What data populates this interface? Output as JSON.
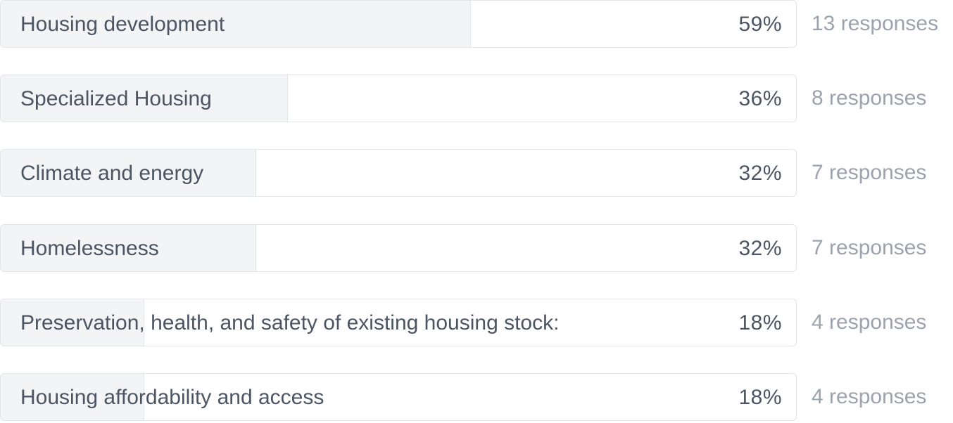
{
  "chart_data": {
    "type": "bar",
    "orientation": "horizontal",
    "categories": [
      "Housing development",
      "Specialized Housing",
      "Climate and energy",
      "Homelessness",
      "Preservation, health, and safety of existing housing stock:",
      "Housing affordability and access"
    ],
    "values": [
      59,
      36,
      32,
      32,
      18,
      18
    ],
    "value_labels": [
      "59%",
      "36%",
      "32%",
      "32%",
      "18%",
      "18%"
    ],
    "counts": [
      13,
      8,
      7,
      7,
      4,
      4
    ],
    "count_labels": [
      "13 responses",
      "8 responses",
      "7 responses",
      "7 responses",
      "4 responses",
      "4 responses"
    ],
    "unit": "%",
    "xlim": [
      0,
      100
    ],
    "title": "",
    "xlabel": "",
    "ylabel": "",
    "grid": false
  },
  "colors": {
    "fill": "#f3f4f6",
    "border": "#e3e5e8",
    "text": "#4b5563",
    "count_text": "#9ca3af",
    "background": "#ffffff"
  }
}
